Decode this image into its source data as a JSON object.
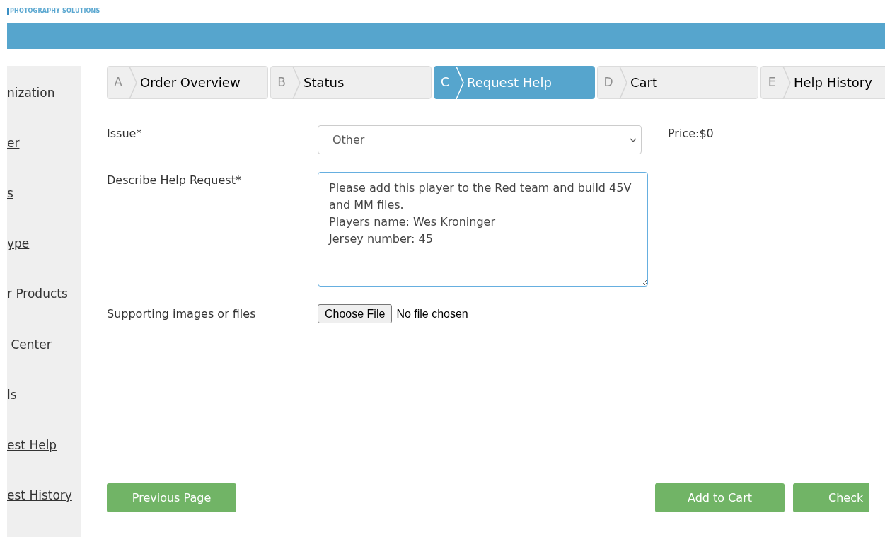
{
  "brand": {
    "logo_text": "PHOTOGRAPHY SOLUTIONS"
  },
  "sidebar": {
    "items": [
      {
        "label": "nization"
      },
      {
        "label": "er"
      },
      {
        "label": "s"
      },
      {
        "label": "ype"
      },
      {
        "label": "r Products"
      },
      {
        "label": " Center"
      },
      {
        "label": "ls"
      },
      {
        "label": "est Help"
      },
      {
        "label": "est History"
      }
    ]
  },
  "steps": [
    {
      "letter": "A",
      "label": "Order Overview",
      "selected": false
    },
    {
      "letter": "B",
      "label": "Status",
      "selected": false
    },
    {
      "letter": "C",
      "label": "Request Help",
      "selected": true
    },
    {
      "letter": "D",
      "label": "Cart",
      "selected": false
    },
    {
      "letter": "E",
      "label": "Help History",
      "selected": false
    }
  ],
  "form": {
    "issue": {
      "label": "Issue*",
      "value": "Other"
    },
    "price": "Price:$0",
    "description": {
      "label": "Describe Help Request*",
      "value": "Please add this player to the Red team and build 45V and MM files.\nPlayers name: Wes Kroninger\nJersey number: 45"
    },
    "files": {
      "label": "Supporting images or files",
      "button": "Choose File",
      "status": "No file chosen"
    }
  },
  "buttons": {
    "previous": "Previous Page",
    "add": "Add to Cart",
    "check": "Check"
  }
}
